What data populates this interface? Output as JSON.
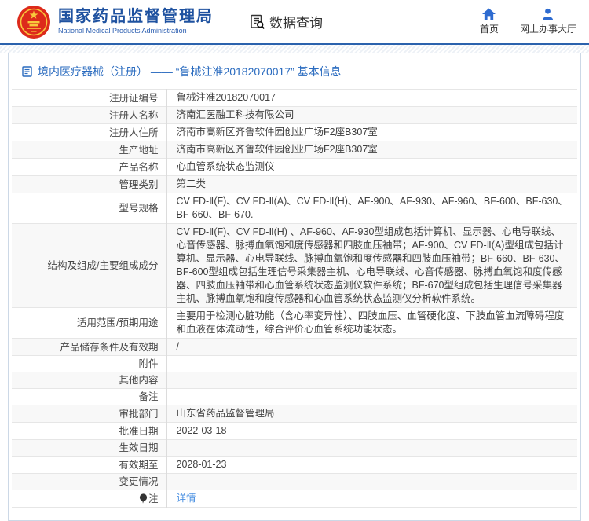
{
  "header": {
    "org_name_cn": "国家药品监督管理局",
    "org_name_en": "National Medical Products Administration",
    "data_query_label": "数据查询",
    "nav": [
      {
        "icon": "home-icon",
        "label": "首页"
      },
      {
        "icon": "person-icon",
        "label": "网上办事大厅"
      }
    ]
  },
  "breadcrumb": {
    "icon": "document-icon",
    "text": "境内医疗器械（注册） —— “鲁械注准20182070017” 基本信息"
  },
  "table": {
    "rows": [
      {
        "label": "注册证编号",
        "value": "鲁械注准20182070017"
      },
      {
        "label": "注册人名称",
        "value": "济南汇医融工科技有限公司"
      },
      {
        "label": "注册人住所",
        "value": "济南市高新区齐鲁软件园创业广场F2座B307室"
      },
      {
        "label": "生产地址",
        "value": "济南市高新区齐鲁软件园创业广场F2座B307室"
      },
      {
        "label": "产品名称",
        "value": "心血管系统状态监测仪"
      },
      {
        "label": "管理类别",
        "value": "第二类"
      },
      {
        "label": "型号规格",
        "value": "CV FD-Ⅱ(F)、CV FD-Ⅱ(A)、CV FD-Ⅱ(H)、AF-900、AF-930、AF-960、BF-600、BF-630、BF-660、BF-670."
      },
      {
        "label": "结构及组成/主要组成成分",
        "value": "CV FD-Ⅱ(F)、CV FD-Ⅱ(H) 、AF-960、AF-930型组成包括计算机、显示器、心电导联线、心音传感器、脉搏血氧饱和度传感器和四肢血压袖带；AF-900、CV FD-Ⅱ(A)型组成包括计算机、显示器、心电导联线、脉搏血氧饱和度传感器和四肢血压袖带；BF-660、BF-630、BF-600型组成包括生理信号采集器主机、心电导联线、心音传感器、脉搏血氧饱和度传感器、四肢血压袖带和心血管系统状态监测仪软件系统；BF-670型组成包括生理信号采集器主机、脉搏血氧饱和度传感器和心血管系统状态监测仪分析软件系统。"
      },
      {
        "label": "适用范围/预期用途",
        "value": "主要用于检测心脏功能（含心率变异性）、四肢血压、血管硬化度、下肢血管血流障碍程度和血液在体流动性，综合评价心血管系统功能状态。"
      },
      {
        "label": "产品储存条件及有效期",
        "value": "/"
      },
      {
        "label": "附件",
        "value": ""
      },
      {
        "label": "其他内容",
        "value": ""
      },
      {
        "label": "备注",
        "value": ""
      },
      {
        "label": "审批部门",
        "value": "山东省药品监督管理局"
      },
      {
        "label": "批准日期",
        "value": "2022-03-18"
      },
      {
        "label": "生效日期",
        "value": ""
      },
      {
        "label": "有效期至",
        "value": "2028-01-23"
      },
      {
        "label": "变更情况",
        "value": ""
      },
      {
        "label": "注",
        "label_icon": "note-bulb-icon",
        "value": "详情",
        "value_is_link": true
      }
    ]
  },
  "colors": {
    "brand_blue": "#1f52a0",
    "icon_blue": "#2e6bd0",
    "breadcrumb_blue": "#2a6bbf",
    "link_blue": "#4a90e2",
    "header_line_blue": "#2b62ad",
    "emblem_red": "#dd2a1b",
    "emblem_gold": "#f8c83c",
    "alt_row_bg": "#f8f8f8",
    "table_border": "#e6e6e6"
  }
}
